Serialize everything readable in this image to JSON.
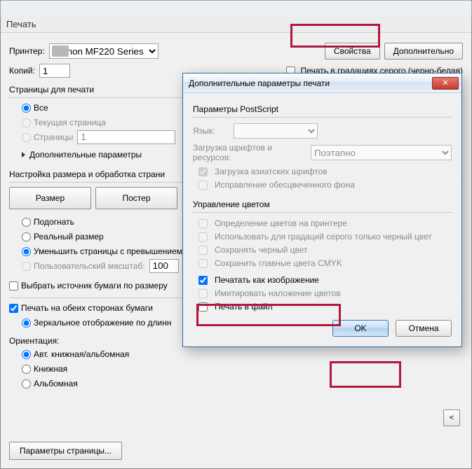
{
  "main": {
    "title": "Печать",
    "printer_label": "Принтер:",
    "printer_value": "Canon MF220 Series",
    "properties_btn": "Свойства",
    "advanced_btn": "Дополнительно",
    "copies_label": "Копий:",
    "copies_value": "1",
    "grayscale_label": "Печать в градациях серого (черно-белая)",
    "pages_group": "Страницы для печати",
    "all": "Все",
    "current_page": "Текущая страница",
    "pages_radio": "Страницы",
    "pages_value": "1",
    "more_params": "Дополнительные параметры",
    "size_group": "Настройка размера и обработка страни",
    "size_btn": "Размер",
    "poster_btn": "Постер",
    "fit": "Подогнать",
    "actual": "Реальный размер",
    "shrink": "Уменьшить страницы с превышением",
    "custom_scale": "Пользовательский масштаб:",
    "scale_value": "100",
    "paper_source": "Выбрать источник бумаги по размеру",
    "duplex": "Печать на обеих сторонах бумаги",
    "mirror": "Зеркальное отображение по длинн",
    "orientation_label": "Ориентация:",
    "orient_auto": "Авт. книжная/альбомная",
    "orient_portrait": "Книжная",
    "orient_landscape": "Альбомная",
    "chevron": "<",
    "page_setup": "Параметры страницы..."
  },
  "modal": {
    "title": "Дополнительные параметры печати",
    "ps_group": "Параметры PostScript",
    "lang_label": "Язык:",
    "font_label": "Загрузка шрифтов и ресурсов:",
    "font_value": "Поэтапно",
    "asian_fonts": "Загрузка азиатских шрифтов",
    "fix_bg": "Исправление обесцвеченного фона",
    "color_group": "Управление цветом",
    "detect_colors": "Определение цветов на принтере",
    "gray_black_only": "Использовать для градаций серого только черный цвет",
    "keep_black": "Сохранять черный цвет",
    "keep_cmyk": "Сохранить главные цвета CMYK",
    "print_as_image": "Печатать как изображение",
    "simulate_overprint": "Имитировать наложение цветов",
    "print_to_file": "Печать в файл",
    "ok": "OK",
    "cancel": "Отмена"
  }
}
